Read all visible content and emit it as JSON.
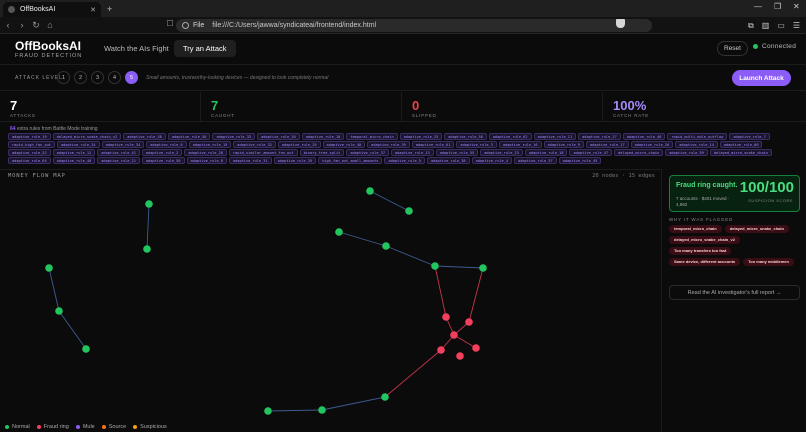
{
  "browser": {
    "tab_title": "OffBooksAI",
    "address_label": "File",
    "url": "file:///C:/Users/jawwa/syndicateai/frontend/index.html"
  },
  "app": {
    "brand": "OffBooksAI",
    "brand_sub": "FRAUD DETECTION",
    "nav": [
      "Watch the AIs Fight",
      "Try an Attack"
    ],
    "active_nav": 1,
    "reset_label": "Reset",
    "status": "Connected"
  },
  "attack": {
    "label": "ATTACK LEVEL",
    "levels": [
      "1",
      "2",
      "3",
      "4",
      "5"
    ],
    "selected": "5",
    "description": "Small amounts, trustworthy-looking devices — designed to look completely normal",
    "launch_label": "Launch Attack"
  },
  "stats": [
    {
      "value": "7",
      "label": "ATTACKS",
      "color": "#ffffff"
    },
    {
      "value": "7",
      "label": "CAUGHT",
      "color": "#22c55e"
    },
    {
      "value": "0",
      "label": "SLIPPED",
      "color": "#ef4444"
    },
    {
      "value": "100%",
      "label": "CATCH RATE",
      "color": "#a78bfa"
    }
  ],
  "rules": {
    "count": "64",
    "text": "extra rules from Battle Mode training",
    "chips": [
      "adaptive_rule_19",
      "delayed_micro_snake_chain_v2",
      "adaptive_rule_58",
      "adaptive_rule_56",
      "adaptive_rule_33",
      "adaptive_rule_20",
      "adaptive_rule_10",
      "temporal_micro_chain",
      "adaptive_rule_25",
      "adaptive_rule_56",
      "adaptive_rule_62",
      "adaptive_rule_11",
      "adaptive_rule_27",
      "adaptive_rule_46",
      "rapid_multi_mule_outflow",
      "adaptive_rule_7",
      "rapid_high_fan_out",
      "adaptive_rule_24",
      "adaptive_rule_34",
      "adaptive_rule_6",
      "adaptive_rule_15",
      "adaptive_rule_32",
      "adaptive_rule_29",
      "adaptive_rule_40",
      "adaptive_rule_39",
      "adaptive_rule_61",
      "adaptive_rule_3",
      "adaptive_rule_16",
      "adaptive_rule_9",
      "adaptive_rule_17",
      "adaptive_rule_26",
      "adaptive_rule_14",
      "adaptive_rule_60",
      "adaptive_rule_52",
      "adaptive_rule_12",
      "adaptive_rule_41",
      "adaptive_rule_2",
      "adaptive_rule_28",
      "rapid_similar_amount_fan_out",
      "binary_tree_split",
      "adaptive_rule_37",
      "adaptive_rule_13",
      "adaptive_rule_55",
      "adaptive_rule_23",
      "adaptive_rule_18",
      "adaptive_rule_47",
      "delayed_micro_chain",
      "adaptive_rule_59",
      "delayed_micro_snake_chain",
      "adaptive_rule_64",
      "adaptive_rule_48",
      "adaptive_rule_21",
      "adaptive_rule_50",
      "adaptive_rule_8",
      "adaptive_rule_31",
      "adaptive_rule_35",
      "high_fan_out_small_amounts",
      "adaptive_rule_5",
      "adaptive_rule_38",
      "adaptive_rule_4",
      "adaptive_rule_57",
      "adaptive_rule_45"
    ]
  },
  "map": {
    "title": "MONEY FLOW MAP",
    "meta": "20 nodes · 15 edges"
  },
  "legend": [
    {
      "label": "Normal",
      "color": "#22c55e"
    },
    {
      "label": "Fraud ring",
      "color": "#f43f5e"
    },
    {
      "label": "Mule",
      "color": "#8b5cf6"
    },
    {
      "label": "Source",
      "color": "#f97316"
    },
    {
      "label": "Suspicious",
      "color": "#f59e0b"
    }
  ],
  "result": {
    "title": "Fraud ring caught.",
    "subtitle": "7 accounts · $401 moved · 4,992",
    "score": "100/100",
    "score_label": "SUSPICION SCORE",
    "why_label": "WHY IT WAS FLAGGED",
    "flags": [
      "temporal_micro_chain",
      "delayed_micro_snake_chain",
      "delayed_micro_snake_chain_v2",
      "Too many transfers too fast",
      "Same device, different accounts",
      "Too many middlemen"
    ],
    "report_label": "Read the AI investigator's full report →"
  }
}
